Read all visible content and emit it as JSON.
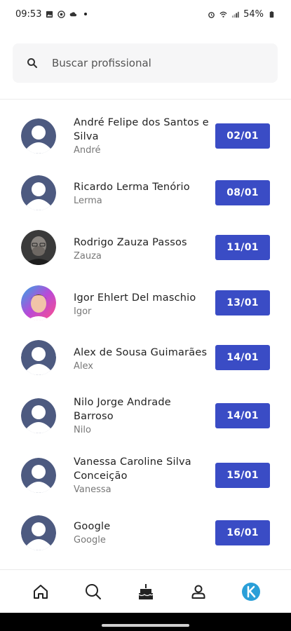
{
  "status_bar": {
    "time": "09:53",
    "battery": "54%"
  },
  "search": {
    "placeholder": "Buscar profissional"
  },
  "professionals": [
    {
      "name": "André Felipe dos Santos e Silva",
      "nickname": "André",
      "date": "02/01",
      "avatar": "default"
    },
    {
      "name": "Ricardo Lerma Tenório",
      "nickname": "Lerma",
      "date": "08/01",
      "avatar": "default"
    },
    {
      "name": "Rodrigo Zauza Passos",
      "nickname": "Zauza",
      "date": "11/01",
      "avatar": "photo"
    },
    {
      "name": "Igor Ehlert Del maschio",
      "nickname": "Igor",
      "date": "13/01",
      "avatar": "photo"
    },
    {
      "name": "Alex de Sousa Guimarães",
      "nickname": "Alex",
      "date": "14/01",
      "avatar": "default"
    },
    {
      "name": "Nilo Jorge Andrade Barroso",
      "nickname": "Nilo",
      "date": "14/01",
      "avatar": "default"
    },
    {
      "name": "Vanessa Caroline Silva Conceição",
      "nickname": "Vanessa",
      "date": "15/01",
      "avatar": "default"
    },
    {
      "name": "Google",
      "nickname": "Google",
      "date": "16/01",
      "avatar": "default"
    }
  ],
  "bottom_nav": [
    {
      "icon": "home-icon"
    },
    {
      "icon": "search-icon"
    },
    {
      "icon": "cake-icon"
    },
    {
      "icon": "person-icon"
    },
    {
      "icon": "app-logo-icon"
    }
  ],
  "colors": {
    "accent": "#3a4cc5",
    "avatar_default": "#4d5a80",
    "logo": "#2a9fd8"
  }
}
